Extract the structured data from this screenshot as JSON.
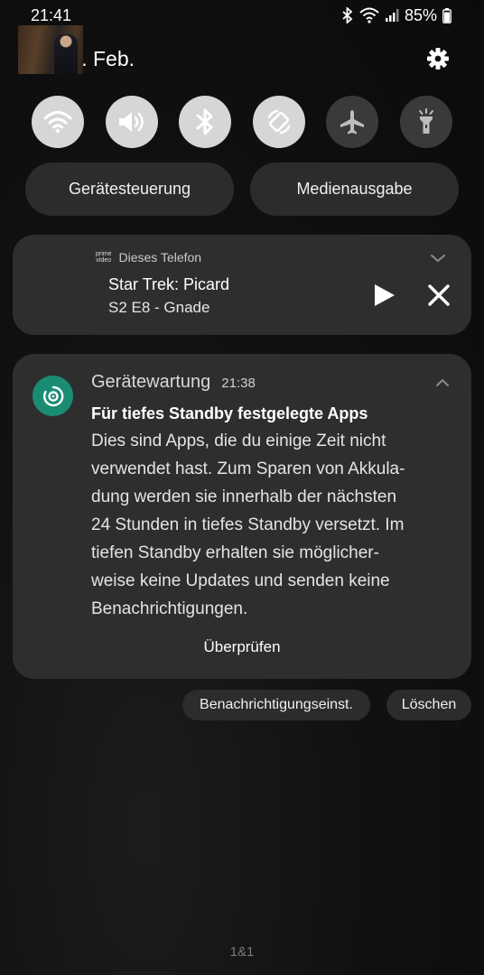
{
  "status_bar": {
    "time": "21:41",
    "battery": "85%",
    "icons": [
      "bluetooth-icon",
      "wifi-icon",
      "signal-icon",
      "battery-icon"
    ]
  },
  "header": {
    "date": "Mi., 8. Feb.",
    "settings_icon": "gear-icon"
  },
  "quick_settings": [
    {
      "name": "wifi",
      "icon": "wifi-icon",
      "active": true
    },
    {
      "name": "sound",
      "icon": "volume-icon",
      "active": true
    },
    {
      "name": "bluetooth",
      "icon": "bluetooth-icon",
      "active": true
    },
    {
      "name": "auto-rotate",
      "icon": "rotate-icon",
      "active": true
    },
    {
      "name": "airplane",
      "icon": "airplane-icon",
      "active": false
    },
    {
      "name": "flashlight",
      "icon": "flashlight-icon",
      "active": false
    }
  ],
  "buttons": {
    "device_control": "Gerätesteuerung",
    "media_output": "Medienausgabe"
  },
  "media": {
    "source_logo_line1": "prime",
    "source_logo_line2": "video",
    "source": "Dieses Telefon",
    "title": "Star Trek: Picard",
    "subtitle": "S2 E8 - Gnade"
  },
  "notification": {
    "app": "Gerätewartung",
    "time": "21:38",
    "title": "Für tiefes Standby festgelegte Apps",
    "body_lines": [
      "Dies sind Apps, die du einige Zeit nicht",
      "verwendet hast. Zum Sparen von Akkula-",
      "dung werden sie innerhalb der nächsten",
      "24 Stunden in tiefes Standby versetzt. Im",
      "tiefen Standby erhalten sie möglicher-",
      "weise keine Updates und senden keine",
      "Benachrichtigungen."
    ],
    "action": "Überprüfen"
  },
  "footer_buttons": {
    "notification_settings": "Benachrichtigungseinst.",
    "clear": "Löschen"
  },
  "carrier": "1&1",
  "colors": {
    "accent_green": "#1a8c74",
    "card_bg": "#2e2e2e",
    "toggle_on": "#d6d6d6",
    "toggle_off": "#3a3a3a"
  }
}
